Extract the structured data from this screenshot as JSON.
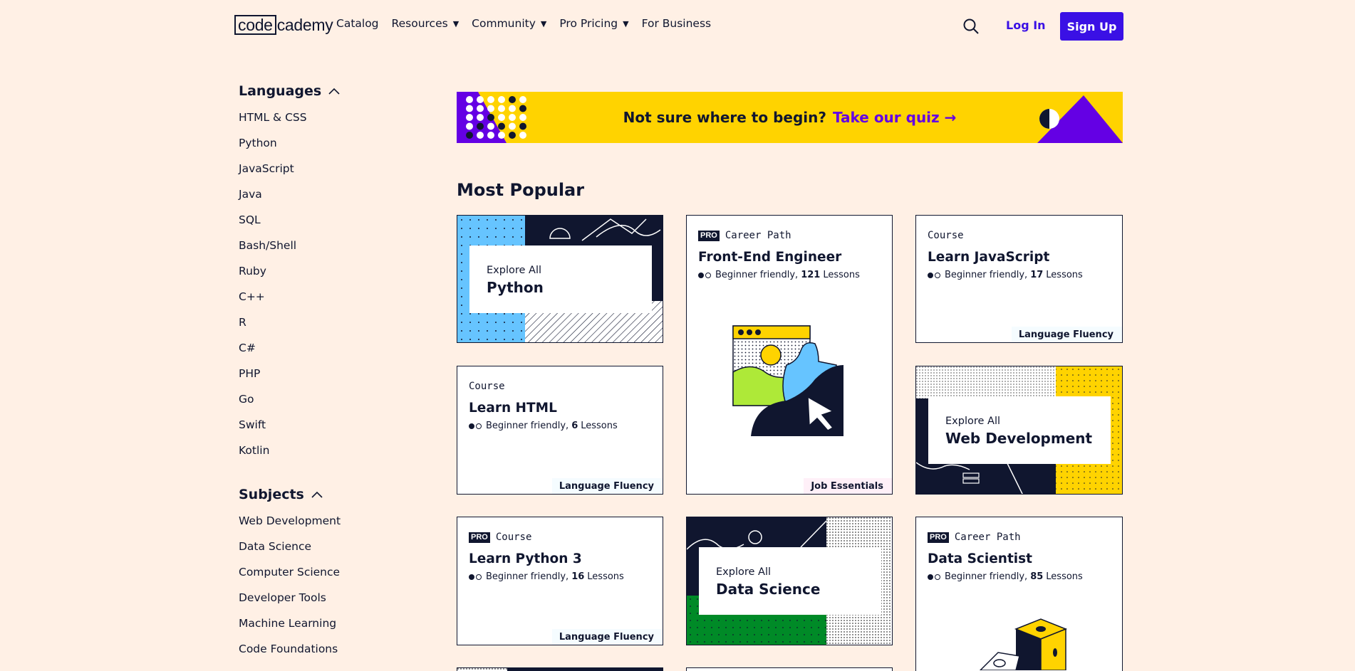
{
  "header": {
    "logo_box": "code",
    "logo_rest": "cademy",
    "nav": [
      {
        "label": "Catalog",
        "has_caret": false
      },
      {
        "label": "Resources",
        "has_caret": true
      },
      {
        "label": "Community",
        "has_caret": true
      },
      {
        "label": "Pro Pricing",
        "has_caret": true
      },
      {
        "label": "For Business",
        "has_caret": false
      }
    ],
    "login_label": "Log In",
    "signup_label": "Sign Up",
    "caret": "▼"
  },
  "sidebar": {
    "languages": {
      "heading": "Languages",
      "items": [
        "HTML & CSS",
        "Python",
        "JavaScript",
        "Java",
        "SQL",
        "Bash/Shell",
        "Ruby",
        "C++",
        "R",
        "C#",
        "PHP",
        "Go",
        "Swift",
        "Kotlin"
      ]
    },
    "subjects": {
      "heading": "Subjects",
      "items": [
        "Web Development",
        "Data Science",
        "Computer Science",
        "Developer Tools",
        "Machine Learning",
        "Code Foundations"
      ]
    }
  },
  "banner": {
    "text": "Not sure where to begin?",
    "link": "Take our quiz →"
  },
  "main": {
    "section_title": "Most Popular",
    "explore": {
      "python": {
        "small": "Explore All",
        "big": "Python"
      },
      "webdev": {
        "small": "Explore All",
        "big": "Web Development"
      },
      "datasci": {
        "small": "Explore All",
        "big": "Data Science"
      }
    },
    "cards": {
      "frontend": {
        "pro": "PRO",
        "kind": "Career Path",
        "title": "Front-End Engineer",
        "level": "Beginner friendly,",
        "count": "121",
        "lessons": "Lessons",
        "tag": "Job Essentials"
      },
      "learnjs": {
        "kind": "Course",
        "title": "Learn JavaScript",
        "level": "Beginner friendly,",
        "count": "17",
        "lessons": "Lessons",
        "tag": "Language Fluency"
      },
      "learnhtml": {
        "kind": "Course",
        "title": "Learn HTML",
        "level": "Beginner friendly,",
        "count": "6",
        "lessons": "Lessons",
        "tag": "Language Fluency"
      },
      "python3": {
        "pro": "PRO",
        "kind": "Course",
        "title": "Learn Python 3",
        "level": "Beginner friendly,",
        "count": "16",
        "lessons": "Lessons",
        "tag": "Language Fluency"
      },
      "datascientist": {
        "pro": "PRO",
        "kind": "Career Path",
        "title": "Data Scientist",
        "level": "Beginner friendly,",
        "count": "85",
        "lessons": "Lessons"
      }
    }
  },
  "colors": {
    "background": "#fff0e5",
    "navy": "#10162f",
    "accent": "#3a10e5",
    "yellow": "#ffd300",
    "purple": "#6400e4",
    "blue": "#66c4ff",
    "green": "#008a27",
    "lime": "#aee938"
  }
}
